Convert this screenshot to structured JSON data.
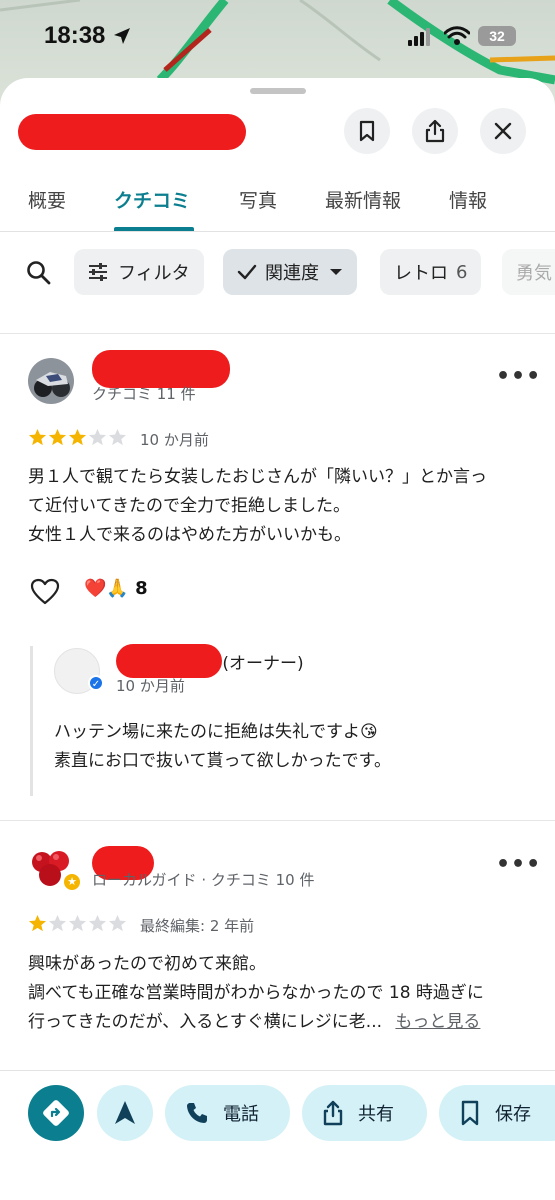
{
  "status_bar": {
    "time": "18:38",
    "battery": "32"
  },
  "place": {
    "name": ""
  },
  "tabs": [
    {
      "label": "概要",
      "active": false
    },
    {
      "label": "クチコミ",
      "active": true
    },
    {
      "label": "写真",
      "active": false
    },
    {
      "label": "最新情報",
      "active": false
    },
    {
      "label": "情報",
      "active": false
    }
  ],
  "filters": {
    "filter_label": "フィルタ",
    "sort_label": "関連度",
    "topics": [
      {
        "label": "レトロ",
        "count": "6"
      },
      {
        "label": "勇気",
        "count": ""
      }
    ]
  },
  "reviews": [
    {
      "meta": "クチコミ 11 件",
      "rating": 3,
      "date": "10 か月前",
      "lines": [
        "男１人で観てたら女装したおじさんが「隣いい？」とか言っ",
        "て近付いてきたので全力で拒絶しました。",
        "女性１人で来るのはやめた方がいいかも。"
      ],
      "reactions": "❤️🙏",
      "reaction_count": "8",
      "owner_reply": {
        "name_suffix": "場 (オーナー)",
        "date": "10 か月前",
        "lines": [
          "ハッテン場に来たのに拒絶は失礼ですよ😘",
          "素直にお口で抜いて貰って欲しかったです。"
        ]
      }
    },
    {
      "meta": "ローカルガイド · クチコミ 10 件",
      "rating": 1,
      "date": "最終編集: 2 年前",
      "lines": [
        "興味があったので初めて来館。",
        "調べても正確な営業時間がわからなかったので 18 時過ぎに",
        "行ってきたのだが、入るとすぐ横にレジに老..."
      ],
      "more_label": "もっと見る"
    }
  ],
  "actions": {
    "call": "電話",
    "share": "共有",
    "save": "保存"
  },
  "colors": {
    "accent": "#0b7f8f",
    "star": "#f4b400",
    "chip_bg": "#eef0f1",
    "action_bg": "#d3f1f6",
    "redaction": "#ee1c1c"
  }
}
